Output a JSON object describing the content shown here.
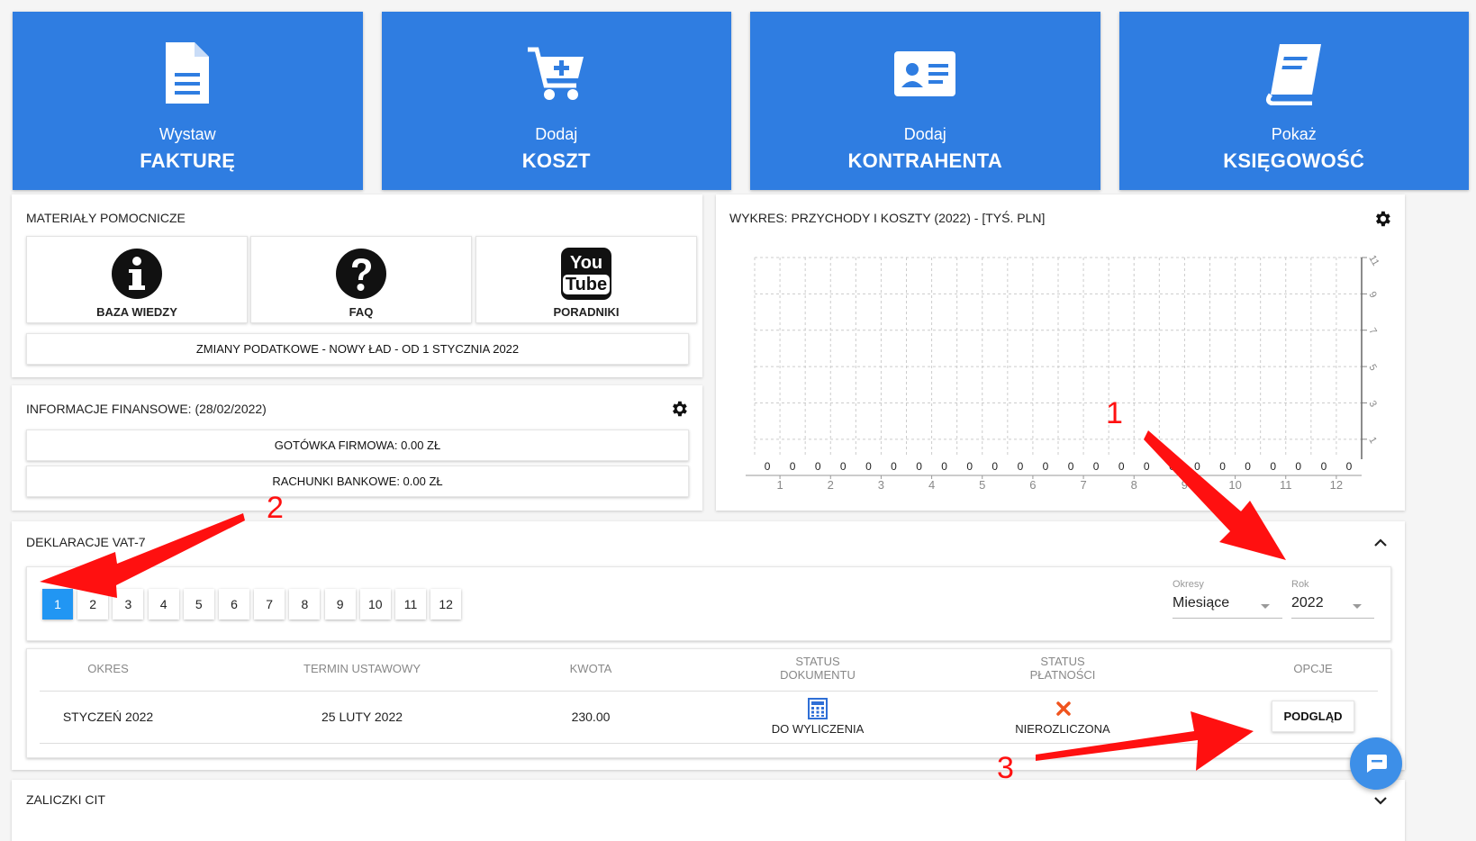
{
  "tiles": [
    {
      "sub": "Wystaw",
      "main": "FAKTURĘ",
      "icon": "document-icon"
    },
    {
      "sub": "Dodaj",
      "main": "KOSZT",
      "icon": "cart-plus-icon"
    },
    {
      "sub": "Dodaj",
      "main": "KONTRAHENTA",
      "icon": "id-card-icon"
    },
    {
      "sub": "Pokaż",
      "main": "KSIĘGOWOŚĆ",
      "icon": "book-icon"
    }
  ],
  "help": {
    "title": "MATERIAŁY POMOCNICZE",
    "items": [
      "BAZA WIEDZY",
      "FAQ",
      "PORADNIKI"
    ],
    "youtube_you": "You",
    "youtube_tube": "Tube",
    "banner": "ZMIANY PODATKOWE - NOWY ŁAD - OD 1 STYCZNIA 2022"
  },
  "finance": {
    "title": "INFORMACJE FINANSOWE: (28/02/2022)",
    "cash": "GOTÓWKA FIRMOWA: 0.00 ZŁ",
    "bank": "RACHUNKI BANKOWE: 0.00 ZŁ"
  },
  "chart_data": {
    "type": "bar",
    "title": "WYKRES: PRZYCHODY I KOSZTY (2022) - [TYŚ. PLN]",
    "categories": [
      "1",
      "2",
      "3",
      "4",
      "5",
      "6",
      "7",
      "8",
      "9",
      "10",
      "11",
      "12"
    ],
    "series": [
      {
        "values": [
          0,
          0,
          0,
          0,
          0,
          0,
          0,
          0,
          0,
          0,
          0,
          0
        ]
      },
      {
        "values": [
          0,
          0,
          0,
          0,
          0,
          0,
          0,
          0,
          0,
          0,
          0,
          0
        ]
      }
    ],
    "y_ticks": [
      "1",
      "3",
      "5",
      "7",
      "9",
      "11"
    ],
    "ylim": [
      0,
      11
    ],
    "grid": true
  },
  "declarations": {
    "title": "DEKLARACJE VAT-7",
    "months": [
      "1",
      "2",
      "3",
      "4",
      "5",
      "6",
      "7",
      "8",
      "9",
      "10",
      "11",
      "12"
    ],
    "active_month": "1",
    "period_label": "Okresy",
    "period_value": "Miesiące",
    "year_label": "Rok",
    "year_value": "2022",
    "headers": {
      "okres": "OKRES",
      "termin": "TERMIN USTAWOWY",
      "kwota": "KWOTA",
      "status_dok_1": "STATUS",
      "status_dok_2": "DOKUMENTU",
      "status_pl_1": "STATUS",
      "status_pl_2": "PŁATNOŚCI",
      "opcje": "OPCJE"
    },
    "row": {
      "okres": "STYCZEŃ 2022",
      "termin": "25 LUTY 2022",
      "kwota": "230.00",
      "status_dok": "DO WYLICZENIA",
      "status_pl": "NIEROZLICZONA",
      "action": "PODGLĄD"
    }
  },
  "cit": {
    "title": "ZALICZKI CIT"
  },
  "annotations": {
    "a1": "1",
    "a2": "2",
    "a3": "3"
  },
  "colors": {
    "brand": "#2f7de1",
    "active": "#2196f3",
    "annotation": "#ff1010"
  }
}
